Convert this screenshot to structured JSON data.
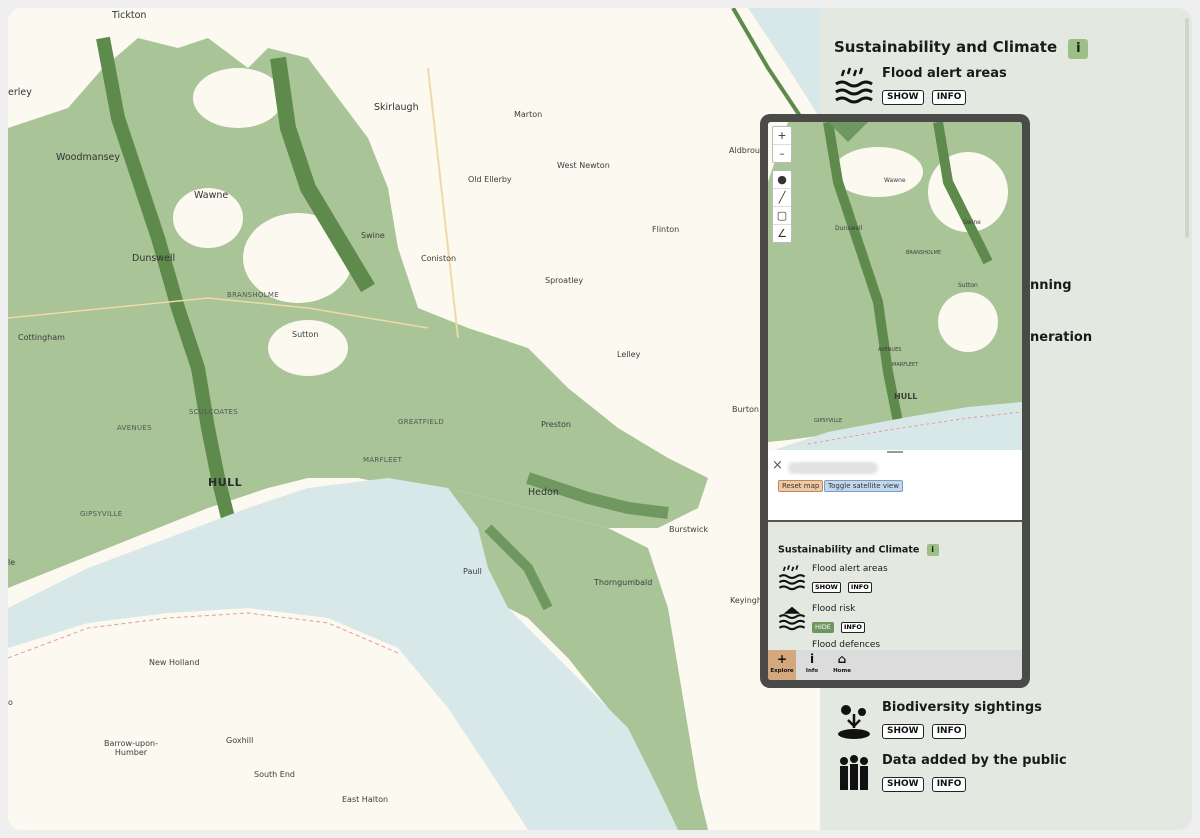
{
  "map": {
    "places": [
      "Tickton",
      "erley",
      "Woodmansey",
      "Wawne",
      "Skirlaugh",
      "Marton",
      "West Newton",
      "Old Ellerby",
      "Aldbrough",
      "Swine",
      "Dunswell",
      "Coniston",
      "Flinton",
      "Sproatley",
      "BRANSHOLME",
      "Sutton",
      "Cottingham",
      "Lelley",
      "SCULCOATES",
      "AVENUES",
      "GREATFIELD",
      "Preston",
      "Burton",
      "MARFLEET",
      "HULL",
      "Hedon",
      "GIPSYVILLE",
      "Paull",
      "Burstwick",
      "Thorngumbald",
      "Keyingh",
      "New Holland",
      "Barrow-upon-\nHumber",
      "Goxhill",
      "South End",
      "East Halton",
      "o",
      "le"
    ]
  },
  "panel": {
    "section_title": "Sustainability and Climate",
    "info_glyph": "i",
    "layers": [
      {
        "name": "Flood alert areas",
        "buttons": [
          "SHOW",
          "INFO"
        ],
        "icon": "flood-alert-icon"
      },
      {
        "name": "Biodiversity sightings",
        "buttons": [
          "SHOW",
          "INFO"
        ],
        "icon": "biodiversity-icon"
      },
      {
        "name": "Data added by the public",
        "buttons": [
          "SHOW",
          "INFO"
        ],
        "icon": "public-data-icon"
      }
    ],
    "partial_labels": [
      "nning",
      "neration"
    ]
  },
  "mobile": {
    "map_controls": [
      "+",
      "–"
    ],
    "tool_icons": [
      "marker-icon",
      "line-icon",
      "polygon-icon",
      "angle-icon"
    ],
    "mini_places": [
      "Wawne",
      "Dunswell",
      "Swine",
      "BRANSHOLME",
      "Sutton",
      "AVENUES",
      "MARFLEET",
      "HULL",
      "GIPSYVILLE"
    ],
    "sheet": {
      "close": "×",
      "reset": "Reset map",
      "toggle": "Toggle satellite view"
    },
    "section_title": "Sustainability and Climate",
    "info_glyph": "i",
    "layers": [
      {
        "name": "Flood alert areas",
        "buttons": [
          "SHOW",
          "INFO"
        ]
      },
      {
        "name": "Flood risk",
        "buttons": [
          "HIDE",
          "INFO"
        ]
      },
      {
        "name": "Flood defences",
        "buttons": []
      }
    ],
    "tabs": [
      {
        "icon": "+",
        "label": "Explore"
      },
      {
        "icon": "i",
        "label": "Info"
      },
      {
        "icon": "⌂",
        "label": "Home"
      }
    ]
  },
  "colors": {
    "flood_light": "#a9c598",
    "flood_dark": "#5e8a4c",
    "water": "#d8e8e8",
    "panel_bg": "#e3e9e1",
    "accent": "#9cbf86"
  }
}
